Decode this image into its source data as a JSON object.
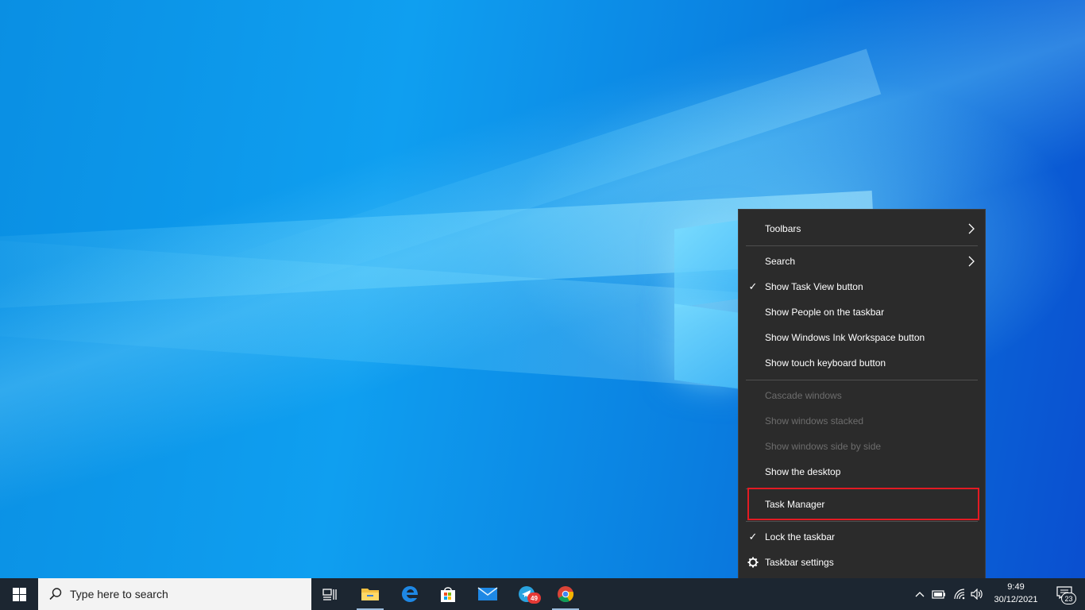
{
  "context_menu": {
    "items": [
      {
        "label": "Toolbars",
        "checked": false,
        "submenu": true,
        "enabled": true
      },
      {
        "label": "Search",
        "checked": false,
        "submenu": true,
        "enabled": true
      },
      {
        "label": "Show Task View button",
        "checked": true,
        "submenu": false,
        "enabled": true
      },
      {
        "label": "Show People on the taskbar",
        "checked": false,
        "submenu": false,
        "enabled": true
      },
      {
        "label": "Show Windows Ink Workspace button",
        "checked": false,
        "submenu": false,
        "enabled": true
      },
      {
        "label": "Show touch keyboard button",
        "checked": false,
        "submenu": false,
        "enabled": true
      },
      {
        "label": "Cascade windows",
        "checked": false,
        "submenu": false,
        "enabled": false
      },
      {
        "label": "Show windows stacked",
        "checked": false,
        "submenu": false,
        "enabled": false
      },
      {
        "label": "Show windows side by side",
        "checked": false,
        "submenu": false,
        "enabled": false
      },
      {
        "label": "Show the desktop",
        "checked": false,
        "submenu": false,
        "enabled": true
      },
      {
        "label": "Task Manager",
        "checked": false,
        "submenu": false,
        "enabled": true,
        "highlighted": true
      },
      {
        "label": "Lock the taskbar",
        "checked": true,
        "submenu": false,
        "enabled": true
      },
      {
        "label": "Taskbar settings",
        "checked": false,
        "submenu": false,
        "enabled": true,
        "icon": "gear-icon"
      }
    ],
    "check_glyph": "✓",
    "highlight_color": "#e31b23"
  },
  "taskbar": {
    "search_placeholder": "Type here to search",
    "apps": [
      {
        "name": "task-view-icon"
      },
      {
        "name": "file-explorer-icon"
      },
      {
        "name": "edge-icon"
      },
      {
        "name": "microsoft-store-icon"
      },
      {
        "name": "mail-icon"
      },
      {
        "name": "telegram-icon",
        "badge": "49"
      },
      {
        "name": "chrome-icon"
      }
    ],
    "clock": {
      "time": "9:49",
      "date": "30/12/2021"
    },
    "notification_count": "23",
    "tray": [
      "chevron-up-icon",
      "battery-icon",
      "wifi-icon",
      "volume-icon"
    ]
  },
  "colors": {
    "taskbar_bg": "#1c2631",
    "menu_bg": "#2b2b2b",
    "desktop_blue": "#0f9ff0"
  }
}
